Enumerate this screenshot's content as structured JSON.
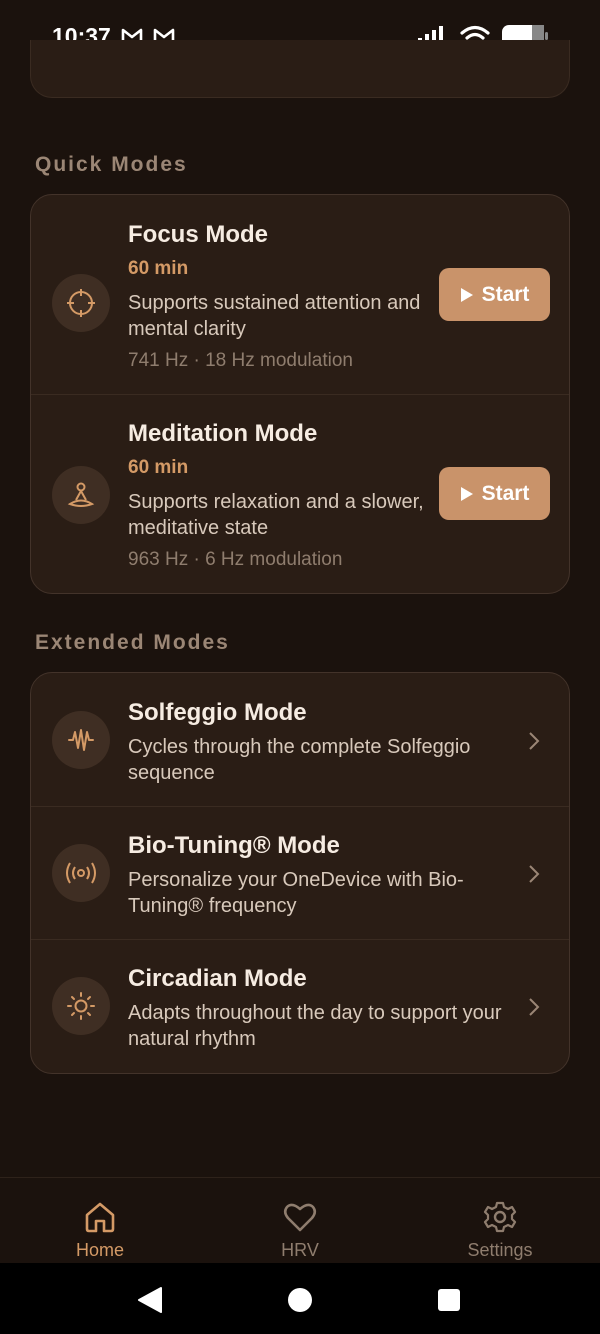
{
  "status_bar": {
    "time": "10:37",
    "mail_icons": [
      "gmail-icon",
      "gmail-icon"
    ]
  },
  "sections": {
    "quick_title": "Quick Modes",
    "extended_title": "Extended Modes"
  },
  "quick_modes": [
    {
      "icon": "target-icon",
      "title": "Focus Mode",
      "duration": "60 min",
      "description": "Supports sustained attention and mental clarity",
      "meta": "741 Hz · 18 Hz modulation",
      "button": "Start"
    },
    {
      "icon": "meditation-icon",
      "title": "Meditation Mode",
      "duration": "60 min",
      "description": "Supports relaxation and a slower, meditative state",
      "meta": "963 Hz · 6 Hz modulation",
      "button": "Start"
    }
  ],
  "extended_modes": [
    {
      "icon": "wave-icon",
      "title": "Solfeggio Mode",
      "description": "Cycles through the complete Solfeggio sequence"
    },
    {
      "icon": "broadcast-icon",
      "title": "Bio-Tuning® Mode",
      "description": "Personalize your OneDevice with Bio-Tuning® frequency"
    },
    {
      "icon": "sun-icon",
      "title": "Circadian Mode",
      "description": "Adapts throughout the day to support your natural rhythm"
    }
  ],
  "bottom_nav": [
    {
      "label": "Home",
      "icon": "home-icon",
      "active": true
    },
    {
      "label": "HRV",
      "icon": "heart-icon",
      "active": false
    },
    {
      "label": "Settings",
      "icon": "gear-icon",
      "active": false
    }
  ],
  "colors": {
    "background": "#1b120d",
    "card": "#2a1d15",
    "accent": "#c9936a",
    "accent_text": "#d49a66",
    "muted": "#9b8675"
  }
}
